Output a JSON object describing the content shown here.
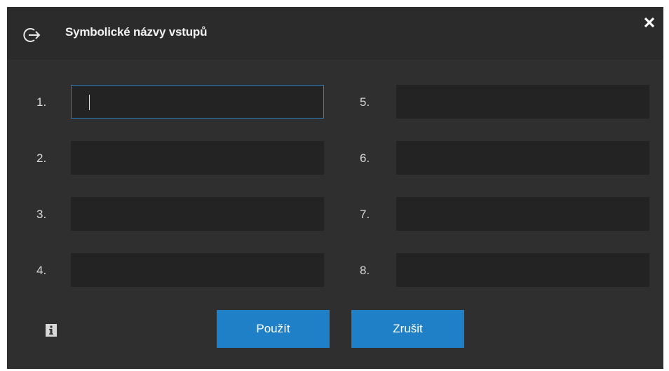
{
  "dialog": {
    "title": "Symbolické názvy vstupů",
    "title_icon": "exit-arrow-icon",
    "close_icon": "close-icon",
    "info_icon": "info-icon"
  },
  "inputs": [
    {
      "label": "1.",
      "value": "",
      "focused": true
    },
    {
      "label": "2.",
      "value": ""
    },
    {
      "label": "3.",
      "value": ""
    },
    {
      "label": "4.",
      "value": ""
    },
    {
      "label": "5.",
      "value": ""
    },
    {
      "label": "6.",
      "value": ""
    },
    {
      "label": "7.",
      "value": ""
    },
    {
      "label": "8.",
      "value": ""
    }
  ],
  "buttons": {
    "apply_label": "Použít",
    "cancel_label": "Zrušit"
  },
  "colors": {
    "background": "#2f2f2f",
    "field": "#232323",
    "accent": "#1f80c8",
    "focus_border": "#2a7fbf"
  }
}
